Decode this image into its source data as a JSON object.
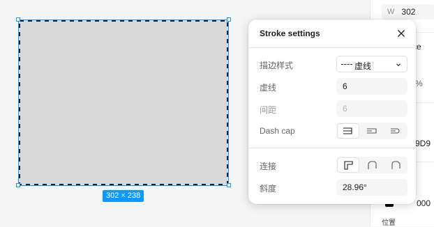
{
  "canvas": {
    "selection_size": "302 × 238"
  },
  "props_panel": {
    "width_label": "W",
    "width_value": "302",
    "partial_text_1": "ce",
    "partial_text_2": "%",
    "partial_text_3": "9D9",
    "partial_text_4": "000",
    "position_label": "位置"
  },
  "stroke_settings": {
    "title": "Stroke settings",
    "rows": [
      {
        "label": "描边样式",
        "value": "虚线"
      },
      {
        "label": "虚线",
        "value": "6"
      },
      {
        "label": "间距",
        "value": "6"
      },
      {
        "label": "Dash cap"
      },
      {
        "label": "连接"
      },
      {
        "label": "斜度",
        "value": "28.96°"
      }
    ],
    "dash_cap_options": [
      "none",
      "square",
      "round"
    ],
    "dash_cap_selected": "none",
    "join_options": [
      "miter",
      "bevel",
      "round"
    ],
    "join_selected": "miter"
  },
  "colors": {
    "accent": "#0d99ff",
    "shape_fill": "#d9d9d9"
  }
}
